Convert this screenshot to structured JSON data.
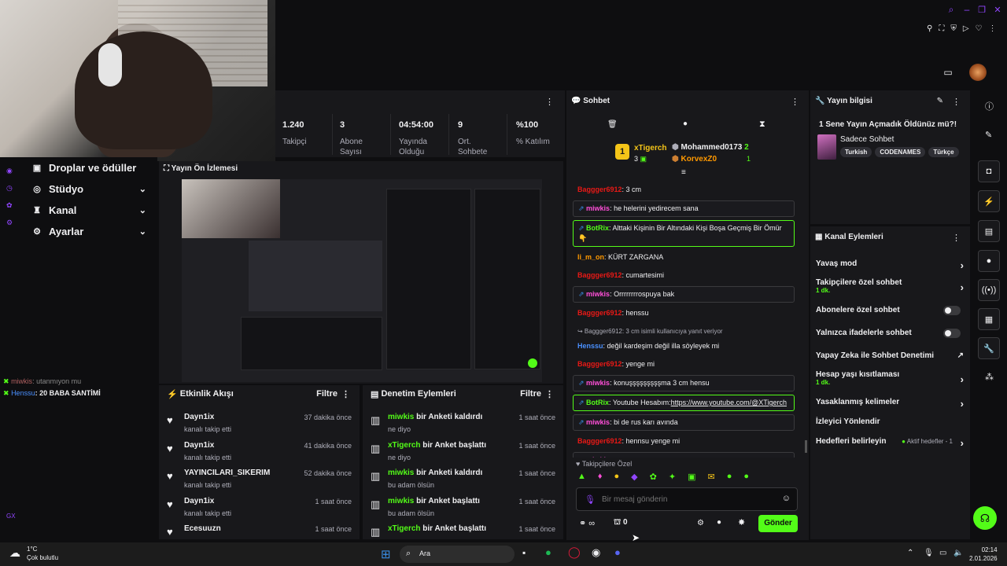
{
  "stats": [
    {
      "value": "1.240",
      "label": "Takipçi"
    },
    {
      "value": "3",
      "label": "Abone Sayısı"
    },
    {
      "value": "04:54:00",
      "label": "Yayında Olduğu"
    },
    {
      "value": "9",
      "label": "Ort. Sohbete"
    },
    {
      "value": "%100",
      "label": "% Katılım"
    }
  ],
  "nav": [
    {
      "label": "Droplar ve ödüller",
      "icon": "gift-icon"
    },
    {
      "label": "Stüdyo",
      "icon": "studio-icon"
    },
    {
      "label": "Kanal",
      "icon": "channel-icon"
    },
    {
      "label": "Ayarlar",
      "icon": "gear-icon"
    }
  ],
  "overlay_chat": [
    {
      "user": "miwkis",
      "text": ": utanmıyon mu"
    },
    {
      "user": "Henssu",
      "text": ": 20 BABA SANTİMİ"
    }
  ],
  "preview": {
    "title": "Yayın Ön İzlemesi"
  },
  "activity": {
    "title": "Etkinlik Akışı",
    "filter": "Filtre",
    "items": [
      {
        "name": "Dayn1ix",
        "sub": "kanalı takip etti",
        "time": "37 dakika önce"
      },
      {
        "name": "Dayn1ix",
        "sub": "kanalı takip etti",
        "time": "41 dakika önce"
      },
      {
        "name": "YAYINCILARI_SIKERIM",
        "sub": "kanalı takip etti",
        "time": "52 dakika önce"
      },
      {
        "name": "Dayn1ix",
        "sub": "kanalı takip etti",
        "time": "1 saat önce"
      },
      {
        "name": "Ecesuuzn",
        "sub": "",
        "time": "1 saat önce"
      }
    ]
  },
  "moderation": {
    "title": "Denetim Eylemleri",
    "filter": "Filtre",
    "items": [
      {
        "user": "miwkis",
        "action": " bir Anketi kaldırdı",
        "sub": "ne diyo",
        "time": "1 saat önce"
      },
      {
        "user": "xTigerch",
        "action": " bir Anket başlattı",
        "sub": "ne diyo",
        "time": "1 saat önce"
      },
      {
        "user": "miwkis",
        "action": " bir Anketi kaldırdı",
        "sub": "bu adam ölsün",
        "time": "1 saat önce"
      },
      {
        "user": "miwkis",
        "action": " bir Anket başlattı",
        "sub": "bu adam ölsün",
        "time": "1 saat önce"
      },
      {
        "user": "xTigerch",
        "action": " bir Anket başlattı",
        "sub": "",
        "time": "1 saat önce"
      }
    ]
  },
  "chat": {
    "title": "Sohbet",
    "leaders": [
      {
        "rank": "1",
        "name": "xTigerch",
        "count": "3"
      },
      {
        "rank": "",
        "name": "Mohammed0173",
        "count": "2"
      },
      {
        "rank": "",
        "name": "KorvexZ0",
        "count": "1"
      }
    ],
    "messages": [
      {
        "user": "Baggger6912",
        "text": ": 3 cm",
        "color": "red",
        "boxed": false
      },
      {
        "user": "miwkis",
        "text": ": he helerini yedirecem sana",
        "color": "pink",
        "boxed": true
      },
      {
        "user": "BotRix",
        "text": ": Alttaki Kişinin Bir Altındaki Kişi Boşa Geçmiş Bir Ömür👇",
        "color": "green",
        "boxed": true
      },
      {
        "user": "li_m_on",
        "text": ": KÜRT ZARGANA",
        "color": "orange",
        "boxed": false
      },
      {
        "user": "Baggger6912",
        "text": ": cumartesimi",
        "color": "red",
        "boxed": false
      },
      {
        "user": "miwkis",
        "text": ": Orrrrrrrrospuya bak",
        "color": "pink",
        "boxed": true
      },
      {
        "user": "Baggger6912",
        "text": ": henssu",
        "color": "red",
        "boxed": false
      },
      {
        "user": "Henssu",
        "text": ": değil kardeşim değil illa söyleyek mi",
        "color": "blue",
        "boxed": false,
        "reply": "↪ Baggger6912: 3 cm isimli kullanıcıya yanıt veriyor"
      },
      {
        "user": "Baggger6912",
        "text": ": yenge mi",
        "color": "red",
        "boxed": false
      },
      {
        "user": "miwkis",
        "text": ": konuşşşşşşşşşma 3 cm hensu",
        "color": "pink",
        "boxed": true
      },
      {
        "user": "BotRix",
        "text": ": Youtube Hesabım:",
        "link": "https://www.youtube.com/@XTigerch",
        "color": "green",
        "boxed": true
      },
      {
        "user": "miwkis",
        "text": ": bi de rus karı avında",
        "color": "pink",
        "boxed": true
      },
      {
        "user": "Baggger6912",
        "text": ": hennsu yenge mi",
        "color": "red",
        "boxed": false
      },
      {
        "user": "miwkis",
        "text": ": utanmıyon mu",
        "color": "pink",
        "boxed": true
      },
      {
        "user": "Henssu",
        "text": ": 20 BABA SANTİMİ",
        "color": "blue",
        "boxed": false
      }
    ],
    "followers_only": "Takipçilere Özel",
    "input_placeholder": "Bir mesaj gönderin",
    "points": "0",
    "send_label": "Gönder"
  },
  "info": {
    "title": "Yayın bilgisi",
    "stream_title": "1 Sene Yayın Açmadık Öldünüz mü?!",
    "category": "Sadece Sohbet",
    "tags": [
      "Turkish",
      "CODENAMES",
      "Türkçe"
    ]
  },
  "channel_actions": {
    "title": "Kanal Eylemleri",
    "items": [
      {
        "label": "Yavaş mod",
        "sub": "",
        "kind": "arrow"
      },
      {
        "label": "Takipçilere özel sohbet",
        "sub": "1 dk.",
        "kind": "arrow"
      },
      {
        "label": "Abonelere özel sohbet",
        "sub": "",
        "kind": "toggle"
      },
      {
        "label": "Yalnızca ifadelerle sohbet",
        "sub": "",
        "kind": "toggle"
      },
      {
        "label": "Yapay Zeka ile Sohbet Denetimi",
        "sub": "",
        "kind": "external"
      },
      {
        "label": "Hesap yaşı kısıtlaması",
        "sub": "1 dk.",
        "kind": "arrow"
      },
      {
        "label": "Yasaklanmış kelimeler",
        "sub": "",
        "kind": "arrow"
      },
      {
        "label": "İzleyici Yönlendir",
        "sub": "",
        "kind": "none"
      },
      {
        "label": "Hedefleri belirleyin",
        "sub": "",
        "kind": "arrow",
        "extra": "Aktif hedefler - 1"
      }
    ]
  },
  "taskbar": {
    "temp": "1°C",
    "weather": "Çok bulutlu",
    "search": "Ara",
    "time": "02:14",
    "date": "2.01.2026"
  },
  "colors": {
    "accent": "#53fc18",
    "panel": "#18181b",
    "bg": "#0e0e10"
  }
}
